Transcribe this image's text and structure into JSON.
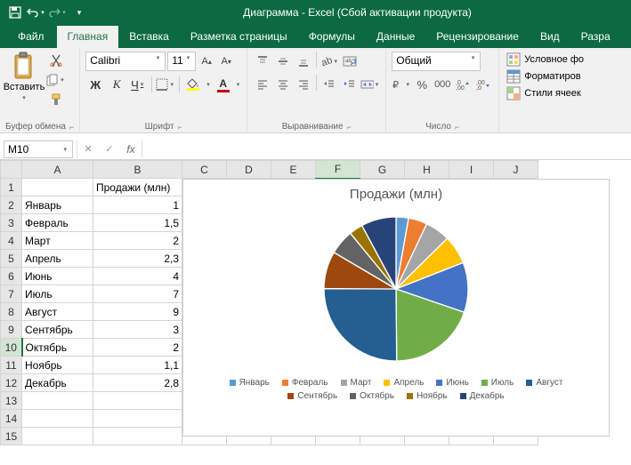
{
  "app": {
    "title": "Диаграмма - Excel (Сбой активации продукта)"
  },
  "tabs": {
    "file": "Файл",
    "items": [
      "Главная",
      "Вставка",
      "Разметка страницы",
      "Формулы",
      "Данные",
      "Рецензирование",
      "Вид",
      "Разра"
    ],
    "active": 0
  },
  "ribbon": {
    "clipboard": {
      "label": "Буфер обмена",
      "paste": "Вставить"
    },
    "font": {
      "label": "Шрифт",
      "name": "Calibri",
      "size": "11"
    },
    "align": {
      "label": "Выравнивание"
    },
    "number": {
      "label": "Число",
      "format": "Общий"
    },
    "styles": {
      "cond": "Условное фо",
      "table": "Форматиров",
      "cell": "Стили ячеек"
    }
  },
  "fbar": {
    "cell": "M10",
    "formula": ""
  },
  "sheet": {
    "cols": [
      "A",
      "B",
      "C",
      "D",
      "E",
      "F",
      "G",
      "H",
      "I",
      "J"
    ],
    "header_b": "Продажи (млн)",
    "rows": [
      {
        "a": "Январь",
        "b": "1"
      },
      {
        "a": "Февраль",
        "b": "1,5"
      },
      {
        "a": "Март",
        "b": "2"
      },
      {
        "a": "Апрель",
        "b": "2,3"
      },
      {
        "a": "Июнь",
        "b": "4"
      },
      {
        "a": "Июль",
        "b": "7"
      },
      {
        "a": "Август",
        "b": "9"
      },
      {
        "a": "Сентябрь",
        "b": "3"
      },
      {
        "a": "Октябрь",
        "b": "2"
      },
      {
        "a": "Ноябрь",
        "b": "1,1"
      },
      {
        "a": "Декабрь",
        "b": "2,8"
      }
    ],
    "selected_row": 10,
    "selected_col": "F"
  },
  "chart_data": {
    "type": "pie",
    "title": "Продажи (млн)",
    "categories": [
      "Январь",
      "Февраль",
      "Март",
      "Апрель",
      "Июнь",
      "Июль",
      "Август",
      "Сентябрь",
      "Октябрь",
      "Ноябрь",
      "Декабрь"
    ],
    "values": [
      1,
      1.5,
      2,
      2.3,
      4,
      7,
      9,
      3,
      2,
      1.1,
      2.8
    ],
    "colors": [
      "#5b9bd5",
      "#ed7d31",
      "#a5a5a5",
      "#ffc000",
      "#4472c4",
      "#70ad47",
      "#255e91",
      "#9e480e",
      "#636363",
      "#997300",
      "#264478"
    ]
  }
}
